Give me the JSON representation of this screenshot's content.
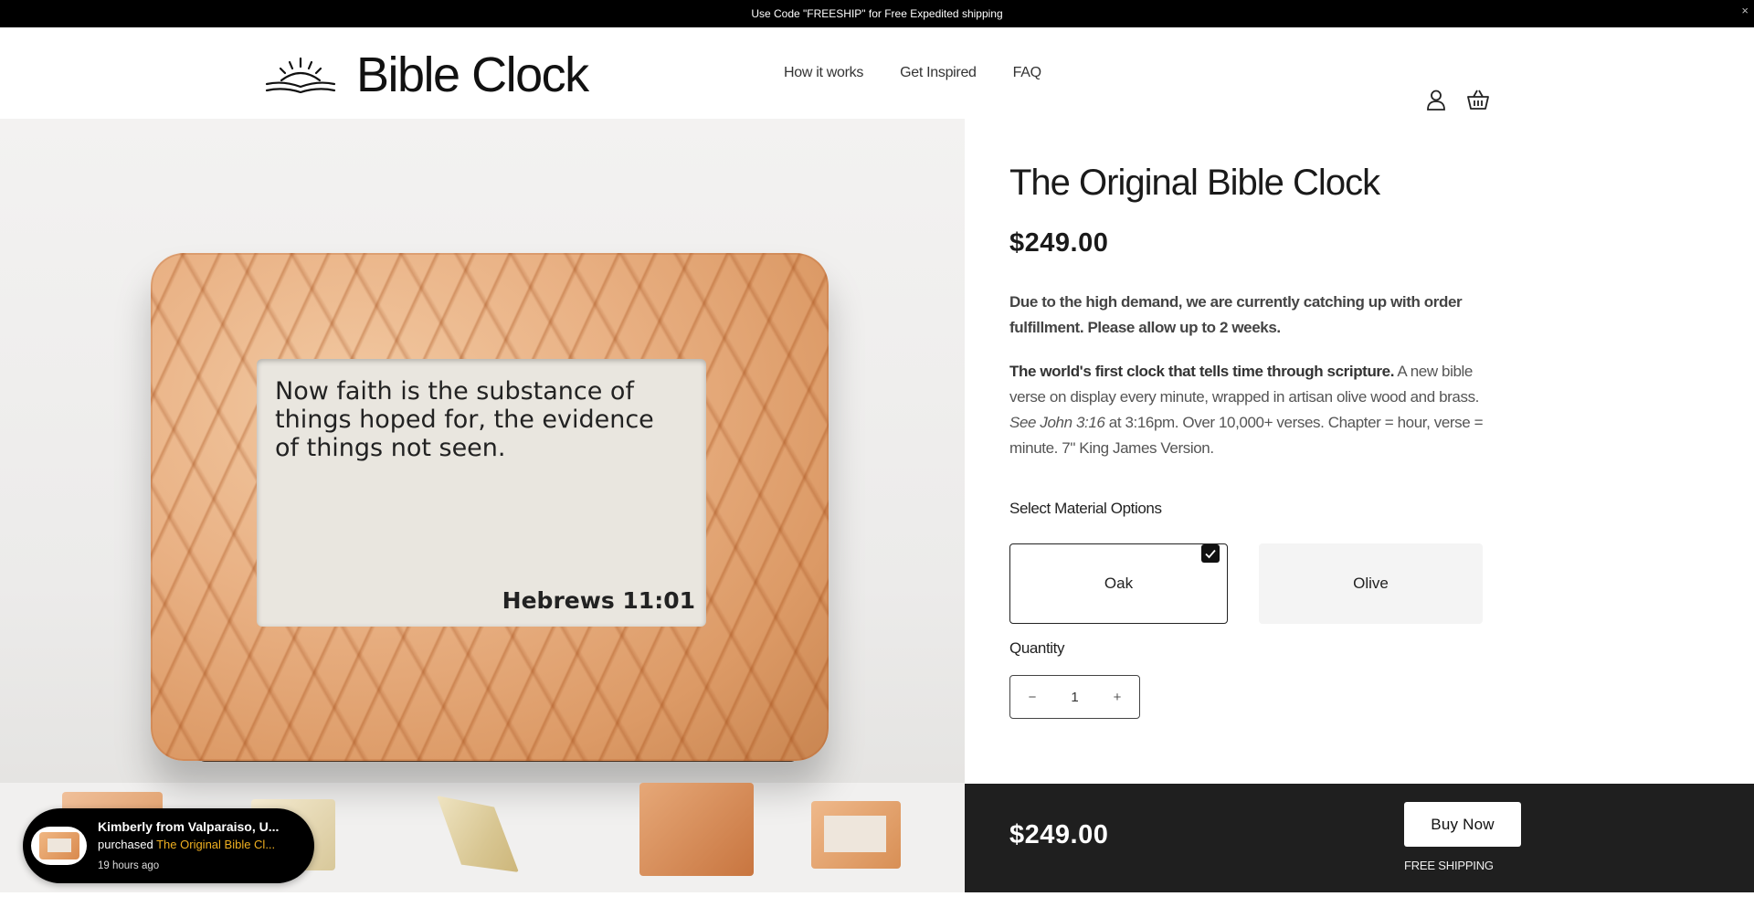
{
  "announcement": {
    "text": "Use Code \"FREESHIP\" for Free Expedited shipping",
    "close": "×"
  },
  "header": {
    "logo_text": "Bible Clock",
    "nav": [
      "How it works",
      "Get Inspired",
      "FAQ"
    ],
    "icons": [
      "account-icon",
      "cart-icon"
    ]
  },
  "gallery": {
    "screen_verse": "Now faith is the substance of things hoped for, the evidence of things not seen.",
    "screen_ref": "Hebrews 11:01"
  },
  "toast": {
    "line1": "Kimberly from Valparaiso, U...",
    "purchased": "purchased",
    "product": "The Original Bible Cl...",
    "time": "19 hours ago"
  },
  "product": {
    "title": "The Original Bible Clock",
    "price": "$249.00",
    "notice": "Due to the high demand, we are currently catching up with order fulfillment. Please allow up to 2 weeks.",
    "desc_bold": "The world's first clock that tells time through scripture.",
    "desc_1": " A new bible verse on display every minute, wrapped in artisan olive wood and brass. ",
    "desc_italic": "See John 3:16",
    "desc_2": " at 3:16pm. Over 10,000+ verses. Chapter = hour, verse = minute. 7\" King James Version.",
    "options_label": "Select Material Options",
    "options": [
      "Oak",
      "Olive"
    ],
    "selected_option": "Oak",
    "quantity_label": "Quantity",
    "quantity": "1",
    "minus": "−",
    "plus": "+"
  },
  "buybar": {
    "price": "$249.00",
    "button": "Buy Now",
    "shipping": "FREE SHIPPING"
  }
}
